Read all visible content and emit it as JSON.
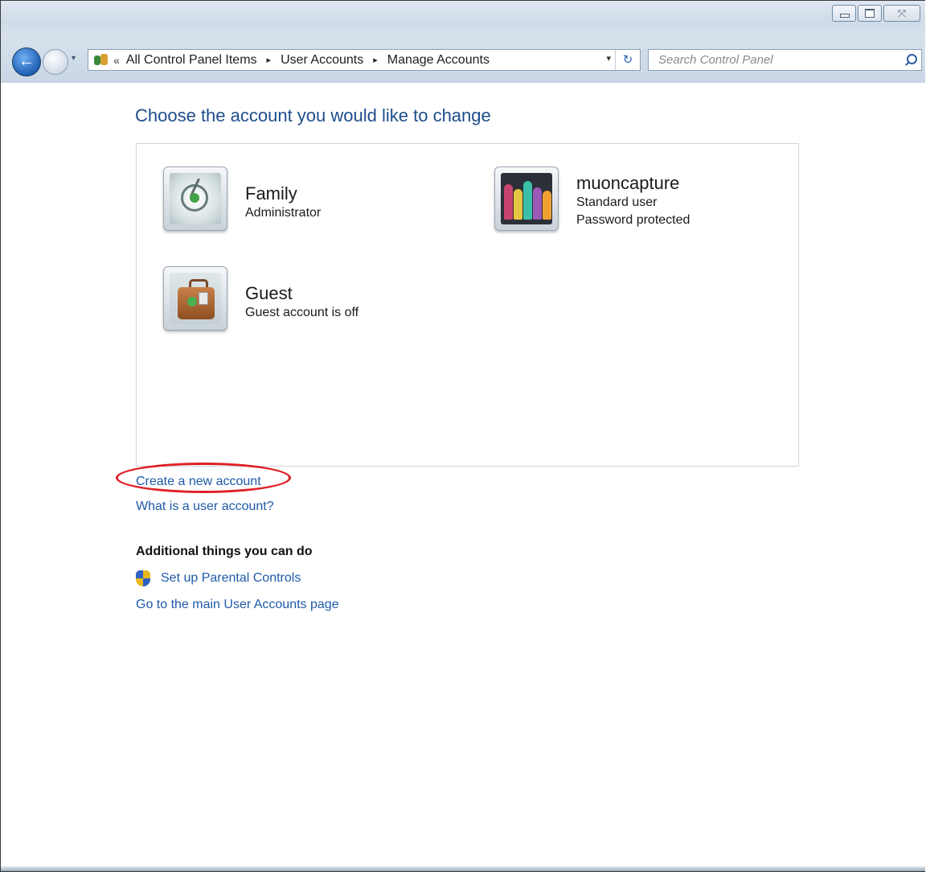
{
  "window": {
    "controls": {
      "minimize_icon": "minimize-icon",
      "maximize_icon": "maximize-icon",
      "close_glyph": "⤧"
    }
  },
  "nav": {
    "breadcrumbs": [
      "All Control Panel Items",
      "User Accounts",
      "Manage Accounts"
    ],
    "overflow_glyph": "«",
    "separator_glyph": "▸",
    "dropdown_glyph": "▾",
    "refresh_glyph": "↻",
    "search_placeholder": "Search Control Panel",
    "search_value": ""
  },
  "main": {
    "heading": "Choose the account you would like to change",
    "accounts": [
      {
        "name": "Family",
        "details": [
          "Administrator"
        ],
        "picture": "satellite-dish-picture"
      },
      {
        "name": "muoncapture",
        "details": [
          "Standard user",
          "Password protected"
        ],
        "picture": "crayons-picture"
      },
      {
        "name": "Guest",
        "details": [
          "Guest account is off"
        ],
        "picture": "suitcase-picture"
      }
    ],
    "links": {
      "create_account": "Create a new account",
      "what_is_user_account": "What is a user account?"
    },
    "additional": {
      "heading": "Additional things you can do",
      "parental_controls": "Set up Parental Controls",
      "main_user_accounts": "Go to the main User Accounts page"
    }
  },
  "colors": {
    "link": "#1e5aa8",
    "heading": "#1e4e8c",
    "highlight_oval": "#e01f26"
  }
}
